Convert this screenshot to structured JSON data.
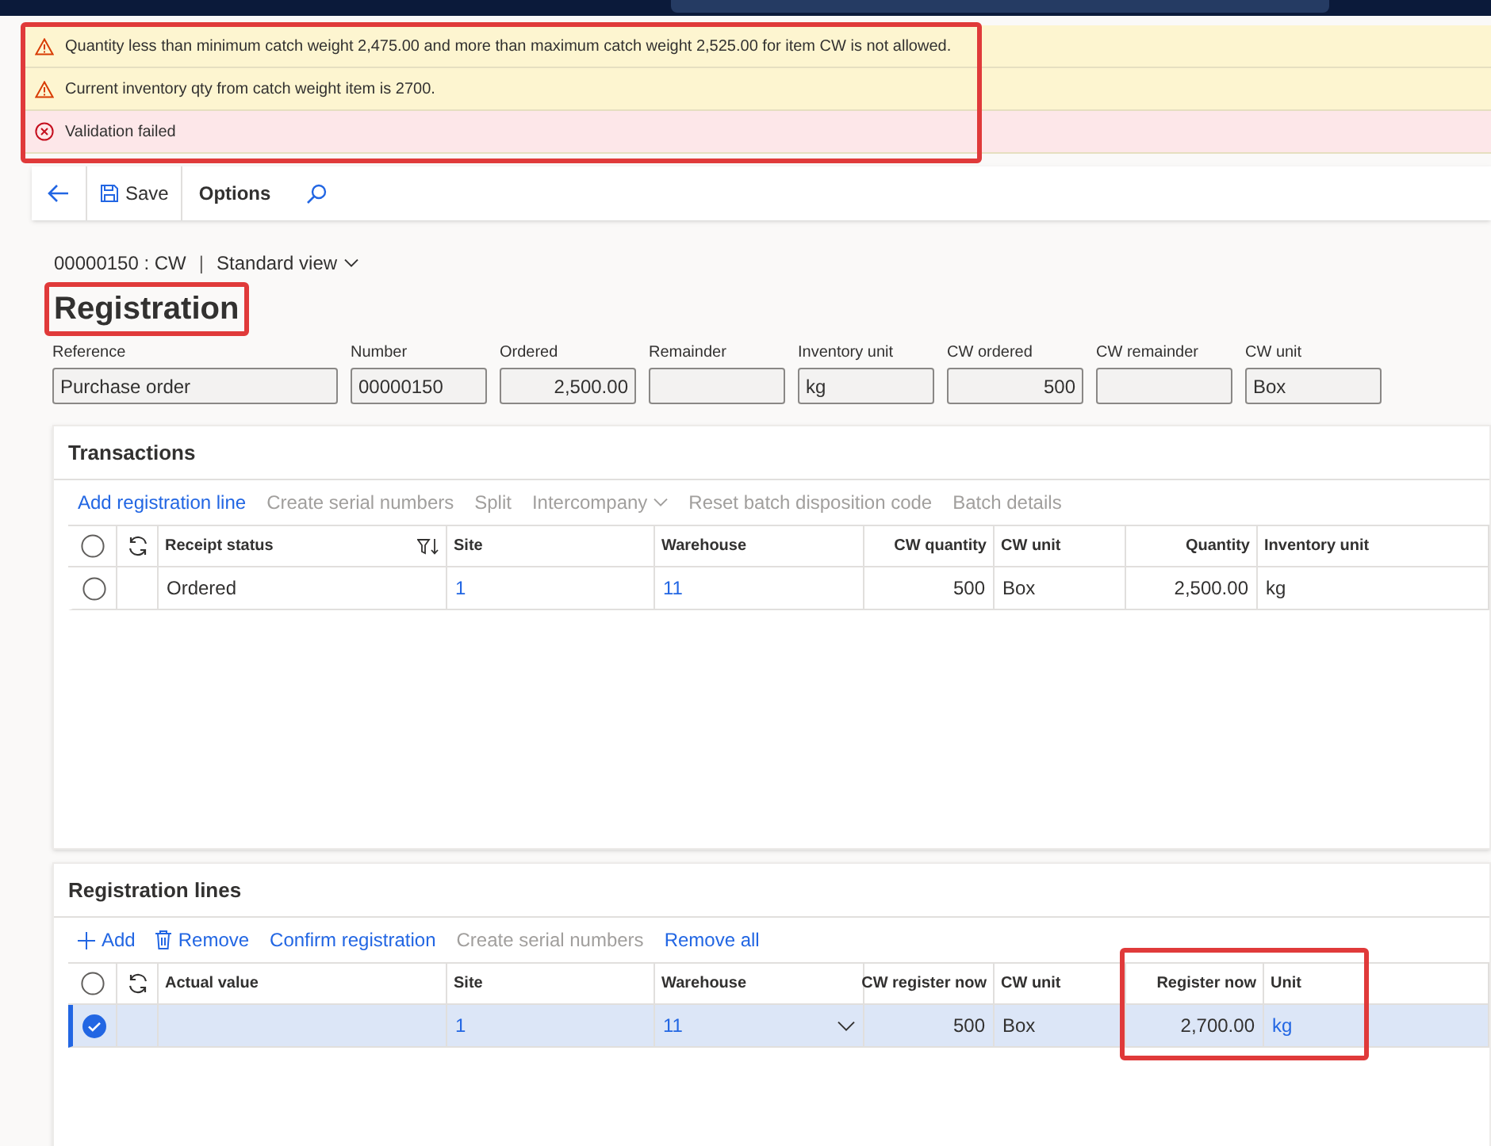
{
  "messages": [
    {
      "kind": "warning",
      "text": "Quantity less than minimum catch weight 2,475.00 and more than maximum catch weight 2,525.00 for item CW is not allowed."
    },
    {
      "kind": "warning",
      "text": "Current inventory qty from catch weight item is 2700."
    },
    {
      "kind": "error",
      "text": "Validation failed"
    }
  ],
  "toolbar": {
    "save": "Save",
    "options": "Options"
  },
  "breadcrumb": {
    "record": "00000150 : CW",
    "separator": "|",
    "view": "Standard view"
  },
  "title": "Registration",
  "header_fields": [
    {
      "label": "Reference",
      "value": "Purchase order"
    },
    {
      "label": "Number",
      "value": "00000150"
    },
    {
      "label": "Ordered",
      "value": "2,500.00"
    },
    {
      "label": "Remainder"
    },
    {
      "label": "Inventory unit",
      "value": "kg"
    },
    {
      "label": "CW ordered",
      "value": "500"
    },
    {
      "label": "CW remainder"
    },
    {
      "label": "CW unit",
      "value": "Box"
    }
  ],
  "sections": [
    {
      "title": "Transactions",
      "all_selected": false,
      "actions": [
        {
          "kind": "plain",
          "label": "Add registration line",
          "disabled": false,
          "menu": false
        },
        {
          "kind": "plain",
          "label": "Create serial numbers",
          "disabled": true,
          "menu": false
        },
        {
          "kind": "plain",
          "label": "Split",
          "disabled": true,
          "menu": false
        },
        {
          "kind": "plain",
          "label": "Intercompany",
          "disabled": true,
          "menu": true
        },
        {
          "kind": "plain",
          "label": "Reset batch disposition code",
          "disabled": true,
          "menu": false
        },
        {
          "kind": "plain",
          "label": "Batch details",
          "disabled": true,
          "menu": false
        }
      ],
      "columns": [
        {
          "label": "Receipt status",
          "filter": true
        },
        {
          "label": "Site",
          "filter": false
        },
        {
          "label": "Warehouse",
          "filter": false
        },
        {
          "label": "CW quantity",
          "filter": false
        },
        {
          "label": "CW unit",
          "filter": false
        },
        {
          "label": "Quantity",
          "filter": false
        },
        {
          "label": "Inventory unit",
          "filter": false
        }
      ],
      "rows": [
        {
          "selected": false,
          "checked": false,
          "cells": [
            {
              "text": "Ordered",
              "link": false,
              "dropdown": false
            },
            {
              "text": "1",
              "link": true,
              "dropdown": false
            },
            {
              "text": "11",
              "link": true,
              "dropdown": false
            },
            {
              "text": "500",
              "link": false,
              "dropdown": false
            },
            {
              "text": "Box",
              "link": false,
              "dropdown": false
            },
            {
              "text": "2,500.00",
              "link": false,
              "dropdown": false
            },
            {
              "text": "kg",
              "link": false,
              "dropdown": false
            }
          ]
        }
      ]
    },
    {
      "title": "Registration lines",
      "all_selected": false,
      "actions": [
        {
          "kind": "add",
          "label": "Add",
          "disabled": false,
          "menu": false
        },
        {
          "kind": "remove",
          "label": "Remove",
          "disabled": false,
          "menu": false
        },
        {
          "kind": "plain",
          "label": "Confirm registration",
          "disabled": false,
          "menu": false
        },
        {
          "kind": "plain",
          "label": "Create serial numbers",
          "disabled": true,
          "menu": false
        },
        {
          "kind": "plain",
          "label": "Remove all",
          "disabled": false,
          "menu": false
        }
      ],
      "columns": [
        {
          "label": "Actual value",
          "filter": false
        },
        {
          "label": "Site",
          "filter": false
        },
        {
          "label": "Warehouse",
          "filter": false
        },
        {
          "label": "CW register now",
          "filter": false
        },
        {
          "label": "CW unit",
          "filter": false
        },
        {
          "label": "Register now",
          "filter": false
        },
        {
          "label": "Unit",
          "filter": false
        }
      ],
      "rows": [
        {
          "selected": true,
          "checked": true,
          "cells": [
            null,
            {
              "text": "1",
              "link": true,
              "dropdown": false
            },
            {
              "text": "11",
              "link": true,
              "dropdown": true
            },
            {
              "text": "500",
              "link": false,
              "dropdown": false
            },
            {
              "text": "Box",
              "link": false,
              "dropdown": false
            },
            {
              "text": "2,700.00",
              "link": false,
              "dropdown": false
            },
            {
              "text": "kg",
              "link": true,
              "dropdown": false
            }
          ]
        }
      ]
    }
  ]
}
